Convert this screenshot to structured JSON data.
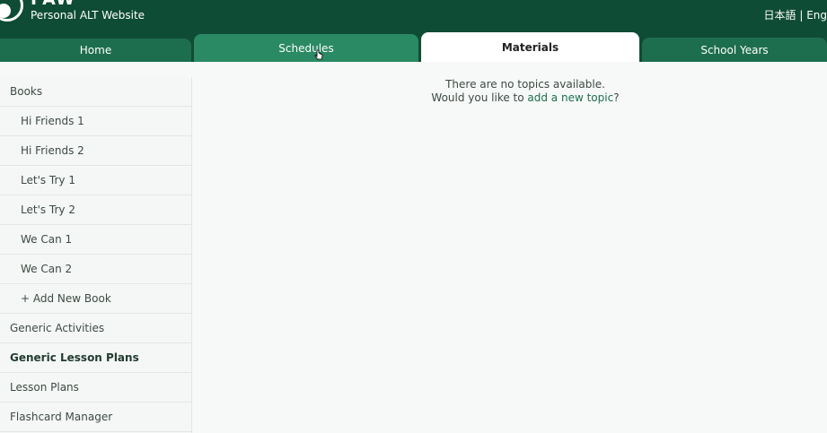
{
  "header": {
    "brand": "PAW",
    "subtitle": "Personal ALT Website",
    "lang_switch": "日本語 | Eng",
    "lang_top": "......"
  },
  "tabs": [
    {
      "label": "Home"
    },
    {
      "label": "Schedules"
    },
    {
      "label": "Materials"
    },
    {
      "label": "School Years"
    }
  ],
  "sidebar": {
    "items": [
      {
        "label": "Books"
      },
      {
        "label": "Hi Friends 1"
      },
      {
        "label": "Hi Friends 2"
      },
      {
        "label": "Let's Try 1"
      },
      {
        "label": "Let's Try 2"
      },
      {
        "label": "We Can 1"
      },
      {
        "label": "We Can 2"
      },
      {
        "label": "+ Add New Book"
      },
      {
        "label": "Generic Activities"
      },
      {
        "label": "Generic Lesson Plans"
      },
      {
        "label": "Lesson Plans"
      },
      {
        "label": "Flashcard Manager"
      }
    ]
  },
  "main": {
    "empty_message": "There are no topics available.",
    "prompt_prefix": "Would you like to ",
    "prompt_link": "add a new topic",
    "prompt_suffix": "?"
  },
  "colors": {
    "header_bg": "#0f4c36",
    "tab_active_hover": "#2a8a64",
    "tab_inactive": "#1d6e4e",
    "link": "#1d6e4e"
  }
}
